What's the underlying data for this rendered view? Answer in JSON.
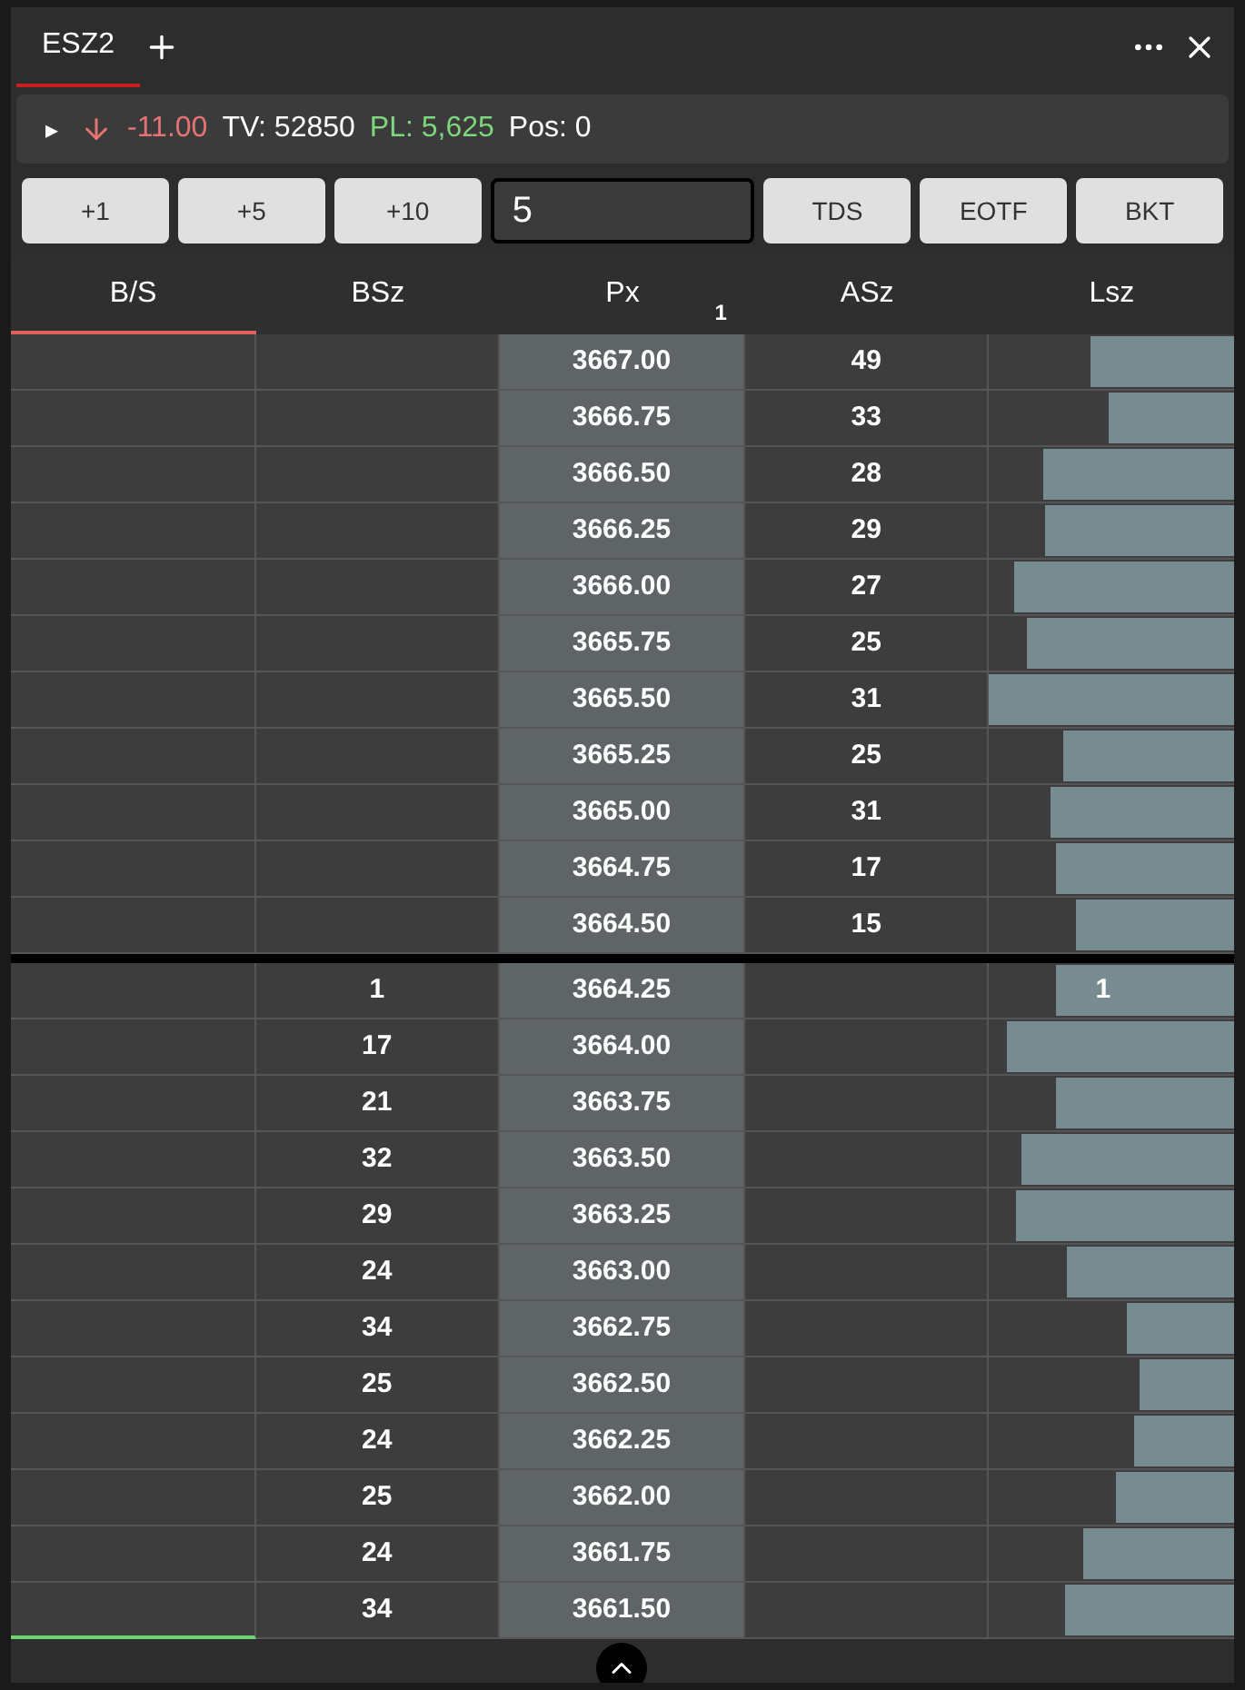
{
  "tabs": [
    {
      "label": "ESZ2",
      "selected": true
    }
  ],
  "info": {
    "expander": "▸",
    "change": "-11.00",
    "down": true,
    "tv": "TV: 52850",
    "pl": "PL: 5,625",
    "pos": "Pos: 0"
  },
  "buttons_left": [
    "+1",
    "+5",
    "+10"
  ],
  "quantity": {
    "value": "5"
  },
  "buttons_right": [
    "TDS",
    "EOTF",
    "BKT"
  ],
  "columns": [
    {
      "label": "B/S",
      "selected": true
    },
    {
      "label": "BSz",
      "selected": false
    },
    {
      "label": "Px",
      "selected": false,
      "badge": "1"
    },
    {
      "label": "ASz",
      "selected": false
    },
    {
      "label": "Lsz",
      "selected": false
    }
  ],
  "ask_rows": [
    {
      "px": "3667.00",
      "asz": "49",
      "level": 0.59
    },
    {
      "px": "3666.75",
      "asz": "33",
      "level": 0.51
    },
    {
      "px": "3666.50",
      "asz": "28",
      "level": 0.78
    },
    {
      "px": "3666.25",
      "asz": "29",
      "level": 0.77
    },
    {
      "px": "3666.00",
      "asz": "27",
      "level": 0.9
    },
    {
      "px": "3665.75",
      "asz": "25",
      "level": 0.85
    },
    {
      "px": "3665.50",
      "asz": "31",
      "level": 1.0
    },
    {
      "px": "3665.25",
      "asz": "25",
      "level": 0.7
    },
    {
      "px": "3665.00",
      "asz": "31",
      "level": 0.75
    },
    {
      "px": "3664.75",
      "asz": "17",
      "level": 0.73
    },
    {
      "px": "3664.50",
      "asz": "15",
      "level": 0.65
    }
  ],
  "bid_rows": [
    {
      "bsz": "1",
      "px": "3664.25",
      "level": 0.73,
      "lsz": "1"
    },
    {
      "bsz": "17",
      "px": "3664.00",
      "level": 0.93
    },
    {
      "bsz": "21",
      "px": "3663.75",
      "level": 0.73
    },
    {
      "bsz": "32",
      "px": "3663.50",
      "level": 0.87
    },
    {
      "bsz": "29",
      "px": "3663.25",
      "level": 0.89
    },
    {
      "bsz": "24",
      "px": "3663.00",
      "level": 0.68
    },
    {
      "bsz": "34",
      "px": "3662.75",
      "level": 0.44
    },
    {
      "bsz": "25",
      "px": "3662.50",
      "level": 0.39
    },
    {
      "bsz": "24",
      "px": "3662.25",
      "level": 0.41
    },
    {
      "bsz": "25",
      "px": "3662.00",
      "level": 0.48
    },
    {
      "bsz": "24",
      "px": "3661.75",
      "level": 0.62
    },
    {
      "bsz": "34",
      "px": "3661.50",
      "level": 0.69
    }
  ]
}
